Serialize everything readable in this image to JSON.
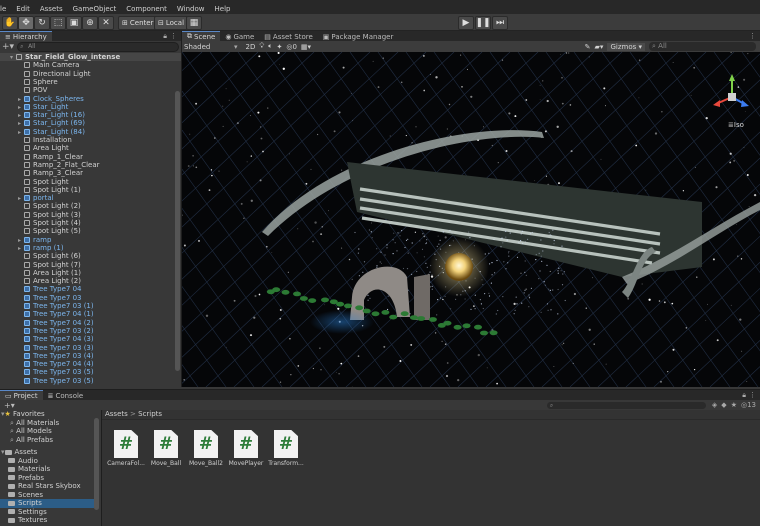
{
  "menu": [
    "le",
    "Edit",
    "Assets",
    "GameObject",
    "Component",
    "Window",
    "Help"
  ],
  "toolbar": {
    "pivot_label": "Center",
    "space_label": "Local"
  },
  "hierarchy": {
    "tab_label": "Hierarchy",
    "search_placeholder": "All",
    "items": [
      {
        "label": "Star_Field_Glow_intense",
        "depth": 0,
        "kind": "root",
        "arrow": "▾"
      },
      {
        "label": "Main Camera",
        "depth": 1,
        "kind": "object"
      },
      {
        "label": "Directional Light",
        "depth": 1,
        "kind": "object"
      },
      {
        "label": "Sphere",
        "depth": 1,
        "kind": "object"
      },
      {
        "label": "POV",
        "depth": 1,
        "kind": "object"
      },
      {
        "label": "Clock_Spheres",
        "depth": 1,
        "kind": "prefab",
        "arrow": "▸",
        "chev": true
      },
      {
        "label": "Star_Light",
        "depth": 1,
        "kind": "prefab",
        "arrow": "▸",
        "chev": true
      },
      {
        "label": "Star_Light (16)",
        "depth": 1,
        "kind": "prefab",
        "arrow": "▸",
        "chev": true
      },
      {
        "label": "Star_Light (69)",
        "depth": 1,
        "kind": "prefab",
        "arrow": "▸",
        "chev": true
      },
      {
        "label": "Star_Light (84)",
        "depth": 1,
        "kind": "prefab",
        "arrow": "▸",
        "chev": true
      },
      {
        "label": "Installation",
        "depth": 1,
        "kind": "object"
      },
      {
        "label": "Area Light",
        "depth": 1,
        "kind": "object"
      },
      {
        "label": "Ramp_1_Clear",
        "depth": 1,
        "kind": "object"
      },
      {
        "label": "Ramp_2_Flat_Clear",
        "depth": 1,
        "kind": "object"
      },
      {
        "label": "Ramp_3_Clear",
        "depth": 1,
        "kind": "object"
      },
      {
        "label": "Spot Light",
        "depth": 1,
        "kind": "object"
      },
      {
        "label": "Spot Light (1)",
        "depth": 1,
        "kind": "object"
      },
      {
        "label": "portal",
        "depth": 1,
        "kind": "prefab",
        "arrow": "▸"
      },
      {
        "label": "Spot Light (2)",
        "depth": 1,
        "kind": "object"
      },
      {
        "label": "Spot Light (3)",
        "depth": 1,
        "kind": "object"
      },
      {
        "label": "Spot Light (4)",
        "depth": 1,
        "kind": "object"
      },
      {
        "label": "Spot Light (5)",
        "depth": 1,
        "kind": "object"
      },
      {
        "label": "ramp",
        "depth": 1,
        "kind": "prefab",
        "arrow": "▸"
      },
      {
        "label": "ramp (1)",
        "depth": 1,
        "kind": "prefab",
        "arrow": "▸"
      },
      {
        "label": "Spot Light (6)",
        "depth": 1,
        "kind": "object"
      },
      {
        "label": "Spot Light (7)",
        "depth": 1,
        "kind": "object"
      },
      {
        "label": "Area Light (1)",
        "depth": 1,
        "kind": "object"
      },
      {
        "label": "Area Light (2)",
        "depth": 1,
        "kind": "object"
      },
      {
        "label": "Tree Type7 04",
        "depth": 1,
        "kind": "prefab"
      },
      {
        "label": "Tree Type7 03",
        "depth": 1,
        "kind": "prefab"
      },
      {
        "label": "Tree Type7 03 (1)",
        "depth": 1,
        "kind": "prefab"
      },
      {
        "label": "Tree Type7 04 (1)",
        "depth": 1,
        "kind": "prefab"
      },
      {
        "label": "Tree Type7 04 (2)",
        "depth": 1,
        "kind": "prefab"
      },
      {
        "label": "Tree Type7 03 (2)",
        "depth": 1,
        "kind": "prefab"
      },
      {
        "label": "Tree Type7 04 (3)",
        "depth": 1,
        "kind": "prefab"
      },
      {
        "label": "Tree Type7 03 (3)",
        "depth": 1,
        "kind": "prefab"
      },
      {
        "label": "Tree Type7 03 (4)",
        "depth": 1,
        "kind": "prefab"
      },
      {
        "label": "Tree Type7 04 (4)",
        "depth": 1,
        "kind": "prefab"
      },
      {
        "label": "Tree Type7 03 (5)",
        "depth": 1,
        "kind": "prefab"
      },
      {
        "label": "Tree Type7 03 (5)",
        "depth": 1,
        "kind": "prefab"
      }
    ]
  },
  "scene": {
    "tabs": [
      {
        "label": "Scene",
        "active": true,
        "icon": "scene-icon"
      },
      {
        "label": "Game",
        "active": false,
        "icon": "game-icon"
      },
      {
        "label": "Asset Store",
        "active": false,
        "icon": "store-icon"
      },
      {
        "label": "Package Manager",
        "active": false,
        "icon": "package-icon"
      }
    ],
    "shading_mode": "Shaded",
    "mode_2d": "2D",
    "hidden_count": "0",
    "gizmos_label": "Gizmos",
    "search_placeholder": "All",
    "projection_label": "Iso"
  },
  "project": {
    "tabs": [
      {
        "label": "Project",
        "active": true
      },
      {
        "label": "Console",
        "active": false
      }
    ],
    "hidden_count": "13",
    "favorites_label": "Favorites",
    "favorites": [
      "All Materials",
      "All Models",
      "All Prefabs"
    ],
    "assets_label": "Assets",
    "folders": [
      "Audio",
      "Materials",
      "Prefabs",
      "Real Stars Skybox",
      "Scenes",
      "Scripts",
      "Settings",
      "Textures"
    ],
    "selected_folder": "Scripts",
    "breadcrumb": [
      "Assets",
      "Scripts"
    ],
    "scripts": [
      "CameraFol...",
      "Move_Ball",
      "Move_Ball2",
      "MovePlayer",
      "Transform..."
    ],
    "script_glyph": "#"
  },
  "colors": {
    "prefab_text": "#7cb6ee",
    "active_tab_accent": "#5a88c8",
    "script_hash": "#2e7d3a"
  }
}
